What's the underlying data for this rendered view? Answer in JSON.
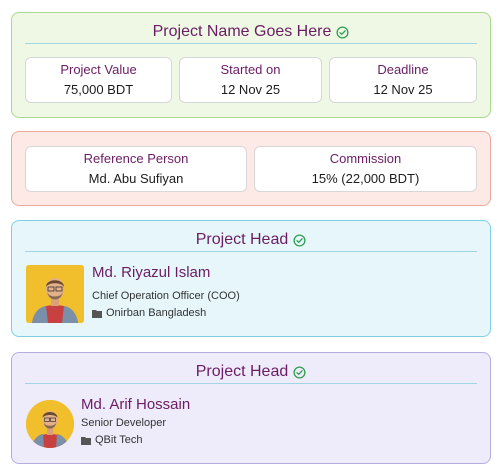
{
  "project": {
    "title": "Project Name Goes Here",
    "stats": [
      {
        "label": "Project Value",
        "value": "75,000 BDT"
      },
      {
        "label": "Started on",
        "value": "12 Nov 25"
      },
      {
        "label": "Deadline",
        "value": "12 Nov 25"
      }
    ]
  },
  "reference": {
    "person_label": "Reference Person",
    "person_value": "Md. Abu Sufiyan",
    "commission_label": "Commission",
    "commission_value": "15% (22,000 BDT)"
  },
  "heads": [
    {
      "title": "Project Head",
      "name": "Md. Riyazul Islam",
      "role": "Chief Operation Officer (COO)",
      "org": "Onirban Bangladesh"
    },
    {
      "title": "Project Head",
      "name": "Md. Arif Hossain",
      "role": "Senior Developer",
      "org": "QBit Tech"
    }
  ],
  "colors": {
    "accent": "#6b1d64",
    "verified": "#2e9e4f",
    "avatar_bg": "#f2bf2c"
  },
  "icons": {
    "verified": "check-circle-icon",
    "organization": "folder-icon"
  }
}
